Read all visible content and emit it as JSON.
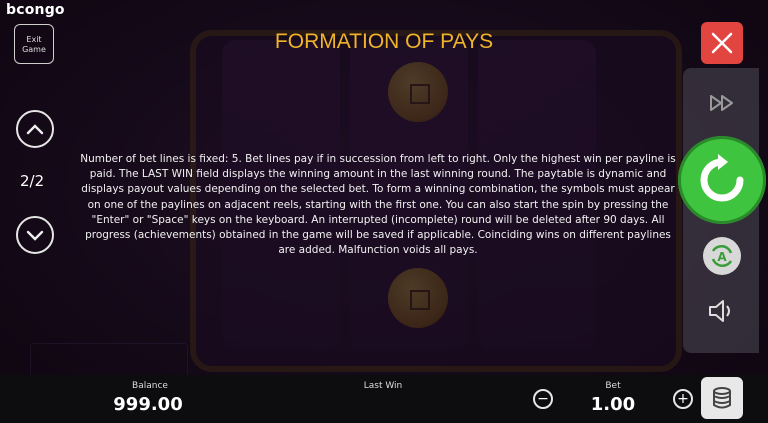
{
  "header": {
    "logo": "bcongo",
    "exit_label": "Exit Game"
  },
  "navigation": {
    "page_indicator": "2/2"
  },
  "help": {
    "title": "FORMATION OF PAYS",
    "text": "Number of bet lines is fixed: 5. Bet lines pay if in succession from left to right. Only the highest win per payline is paid. The LAST WIN field displays the winning amount in the last winning round. The paytable is dynamic and displays payout values depending on the selected bet. To form a winning combination, the symbols must appear on one of the paylines on adjacent reels, starting with the first one. You can also start the spin by pressing the \"Enter\" or \"Space\" keys on the keyboard. An interrupted (incomplete) round will be deleted after 90 days. All progress (achievements) obtained in the game will be saved if applicable. Coinciding wins on different paylines are added. Malfunction voids all pays."
  },
  "controls": {
    "close_icon": "close-x-icon",
    "fast_forward_icon": "fast-forward-icon",
    "spin_icon": "refresh-icon",
    "autoplay_letter": "A",
    "sound_icon": "speaker-icon",
    "stake_icon": "coin-stack-icon"
  },
  "footer": {
    "balance_label": "Balance",
    "balance_value": "999.00",
    "last_win_label": "Last Win",
    "bet_label": "Bet",
    "bet_value": "1.00",
    "minus_symbol": "−",
    "plus_symbol": "+"
  },
  "colors": {
    "title": "#f0b428",
    "close_button": "#e2443f",
    "spin_button": "#3fc43f",
    "bottom_bar": "#0d0d10"
  }
}
